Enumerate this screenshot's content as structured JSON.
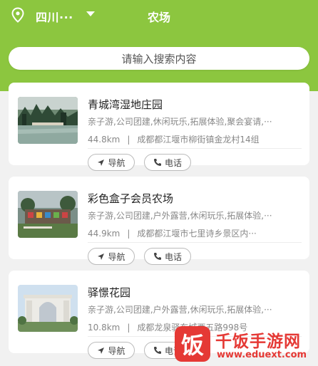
{
  "header": {
    "location": "四川···",
    "title": "农场",
    "color": "#8cc63f"
  },
  "search": {
    "placeholder": "请输入搜索内容"
  },
  "cards": [
    {
      "name": "青城湾湿地庄园",
      "tags": "亲子游,公司团建,休闲玩乐,拓展体验,聚会宴请,···",
      "distance": "44.8km",
      "address": "成都都江堰市柳街镇金龙村14组",
      "nav_label": "导航",
      "call_label": "电话"
    },
    {
      "name": "彩色盒子会员农场",
      "tags": "亲子游,公司团建,户外露营,休闲玩乐,拓展体验,···",
      "distance": "44.9km",
      "address": "成都都江堰市七里诗乡景区内···",
      "nav_label": "导航",
      "call_label": "电话"
    },
    {
      "name": "驿憬花园",
      "tags": "亲子游,公司团建,户外露营,休闲玩乐,拓展体验,···",
      "distance": "10.8km",
      "address": "成都龙泉驿东城西五路998号",
      "nav_label": "导航",
      "call_label": "电话"
    }
  ],
  "watermark": {
    "logo_char": "饭",
    "title": "千饭手游网",
    "url": "www.eduext.com",
    "color": "#e53935"
  }
}
